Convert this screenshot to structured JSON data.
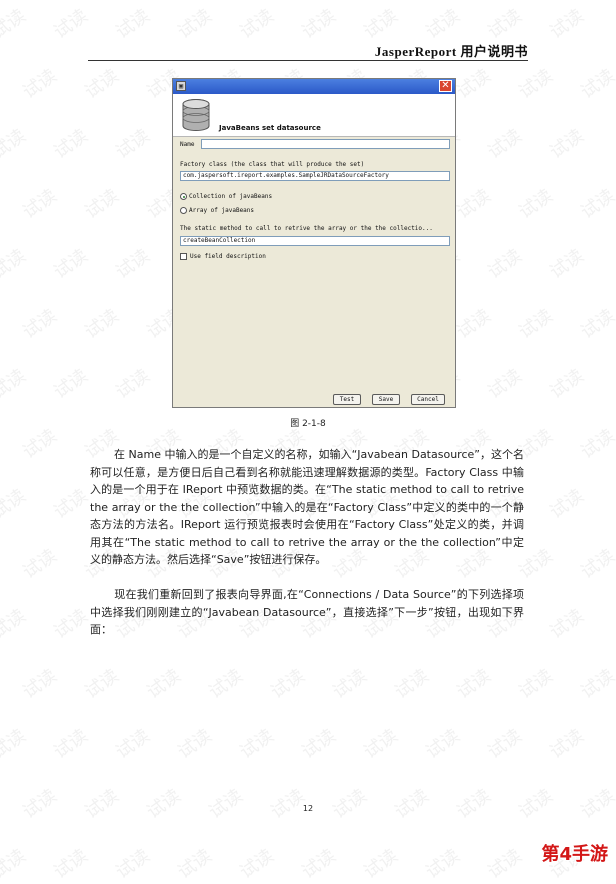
{
  "header": {
    "title": "JasperReport 用户说明书"
  },
  "watermark_text": "试读",
  "dialog": {
    "banner_title": "JavaBeans set datasource",
    "name_label": "Name",
    "name_value": "",
    "factory_label": "Factory class (the class that will produce the set)",
    "factory_value": "com.jaspersoft.ireport.examples.SampleJRDataSourceFactory",
    "option_collection": "Collection of javaBeans",
    "option_array": "Array of javaBeans",
    "static_method_label": "The static method to call to retrive the array or the the collectio...",
    "static_method_value": "createBeanCollection",
    "use_field_description": "Use field description",
    "buttons": {
      "test": "Test",
      "save": "Save",
      "cancel": "Cancel"
    }
  },
  "caption": "图 2-1-8",
  "paragraphs": [
    "在 Name 中输入的是一个自定义的名称，如输入“Javabean Datasource”，这个名称可以任意，是方便日后自己看到名称就能迅速理解数据源的类型。Factory Class 中输入的是一个用于在 IReport 中预览数据的类。在“The static method to call to retrive the array or the the collection”中输入的是在“Factory Class”中定义的类中的一个静态方法的方法名。IReport 运行预览报表时会使用在“Factory Class”处定义的类，并调用其在“The static method to call to retrive the array or the the collection”中定义的静态方法。然后选择“Save”按钮进行保存。",
    "现在我们重新回到了报表向导界面,在“Connections / Data Source”的下列选择项中选择我们刚刚建立的“Javabean Datasource”，直接选择”下一步”按钮，出现如下界面："
  ],
  "page_number": "12",
  "logo_text": "第4手游"
}
